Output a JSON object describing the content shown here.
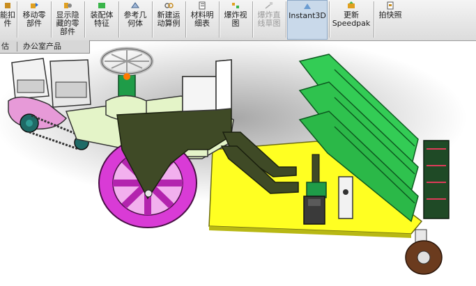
{
  "toolbar": {
    "buttons": [
      {
        "label": "能扣\n件",
        "icon": "smart-fastener-icon"
      },
      {
        "label": "移动零\n部件",
        "icon": "move-component-icon"
      },
      {
        "label": "显示隐\n藏的零\n部件",
        "icon": "show-hidden-icon"
      },
      {
        "label": "装配体\n特征",
        "icon": "assembly-feature-icon"
      },
      {
        "label": "参考几\n何体",
        "icon": "reference-geometry-icon"
      },
      {
        "label": "新建运\n动算例",
        "icon": "new-motion-study-icon"
      },
      {
        "label": "材料明\n细表",
        "icon": "bill-of-materials-icon"
      },
      {
        "label": "爆炸视\n图",
        "icon": "exploded-view-icon"
      },
      {
        "label": "爆炸直\n线草图",
        "icon": "explode-line-sketch-icon"
      },
      {
        "label": "Instant3D",
        "icon": "instant3d-icon"
      },
      {
        "label": "更新\nSpeedpak",
        "icon": "speedpak-icon"
      },
      {
        "label": "拍快照",
        "icon": "snapshot-icon"
      }
    ]
  },
  "tabs": [
    {
      "label": "估"
    },
    {
      "label": "办公室产品"
    }
  ],
  "colors": {
    "toolbar_bg": "#e6e6e6",
    "active_button": "#c9d9ea",
    "green_parts": "#33cc55",
    "dark_frame": "#3f4a26",
    "yellow_plate": "#ffff22",
    "magenta_wheel": "#dd33dd"
  }
}
